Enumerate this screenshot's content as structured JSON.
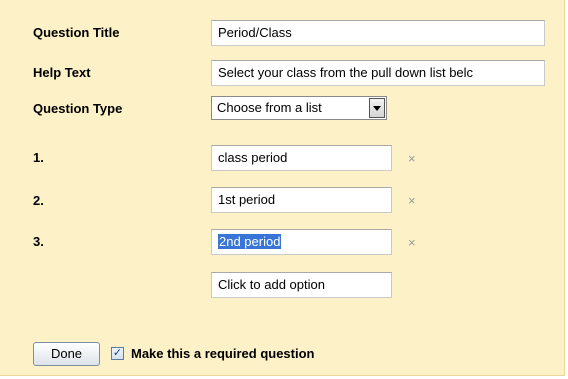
{
  "form": {
    "question_title_label": "Question Title",
    "question_title_value": "Period/Class",
    "help_text_label": "Help Text",
    "help_text_value": "Select your class from the pull down list belc",
    "question_type_label": "Question Type",
    "question_type_selected": "Choose from a list"
  },
  "options": [
    {
      "number": "1.",
      "value": "class period",
      "selected": false
    },
    {
      "number": "2.",
      "value": "1st period",
      "selected": false
    },
    {
      "number": "3.",
      "value": "2nd period",
      "selected": true
    }
  ],
  "add_option_placeholder": "Click to add option",
  "remove_glyph": "×",
  "done_label": "Done",
  "required": {
    "checked": true,
    "check_glyph": "✓",
    "label": "Make this a required question"
  },
  "colors": {
    "panel_background": "#fdf1c7",
    "selection_highlight": "#3875d7"
  }
}
